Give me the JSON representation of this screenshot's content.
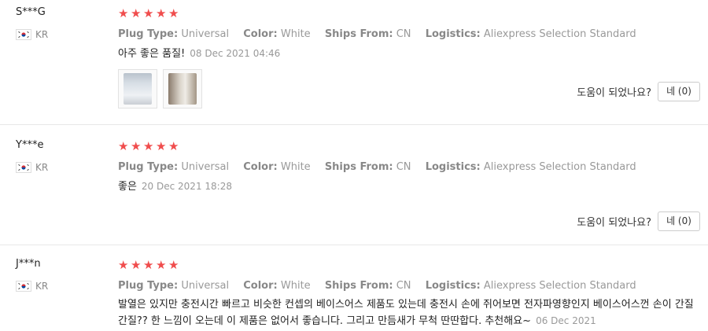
{
  "reviews": [
    {
      "user": "S***G",
      "country": "KR",
      "stars": 5,
      "plug_type_label": "Plug Type:",
      "plug_type": "Universal",
      "color_label": "Color:",
      "color": "White",
      "ships_from_label": "Ships From:",
      "ships_from": "CN",
      "logistics_label": "Logistics:",
      "logistics": "Aliexpress Selection Standard",
      "text": "아주 좋은 품질!",
      "date": "08 Dec 2021 04:46",
      "helpful_question": "도움이 되었나요?",
      "helpful_button": "네 (0)"
    },
    {
      "user": "Y***e",
      "country": "KR",
      "stars": 5,
      "plug_type_label": "Plug Type:",
      "plug_type": "Universal",
      "color_label": "Color:",
      "color": "White",
      "ships_from_label": "Ships From:",
      "ships_from": "CN",
      "logistics_label": "Logistics:",
      "logistics": "Aliexpress Selection Standard",
      "text": "좋은",
      "date": "20 Dec 2021 18:28",
      "helpful_question": "도움이 되었나요?",
      "helpful_button": "네 (0)"
    },
    {
      "user": "J***n",
      "country": "KR",
      "stars": 5,
      "plug_type_label": "Plug Type:",
      "plug_type": "Universal",
      "color_label": "Color:",
      "color": "White",
      "ships_from_label": "Ships From:",
      "ships_from": "CN",
      "logistics_label": "Logistics:",
      "logistics": "Aliexpress Selection Standard",
      "text": "발열은 있지만 충전시간 빠르고 비슷한 컨셉의 베이스어스 제품도 있는데 충전시 손에 쥐어보면 전자파영향인지 베이스어스껀 손이 간질간질?? 한 느낌이 오는데 이 제품은 없어서 좋습니다. 그리고 만듬새가 무척 딴딴합다. 추천해요~",
      "date": "06 Dec 2021"
    }
  ],
  "colors": {
    "star": "#f04d4d",
    "divider": "#e8e8e8",
    "muted": "#999999"
  },
  "icons": {
    "star": "star-icon",
    "flag": "korea-flag-icon"
  }
}
